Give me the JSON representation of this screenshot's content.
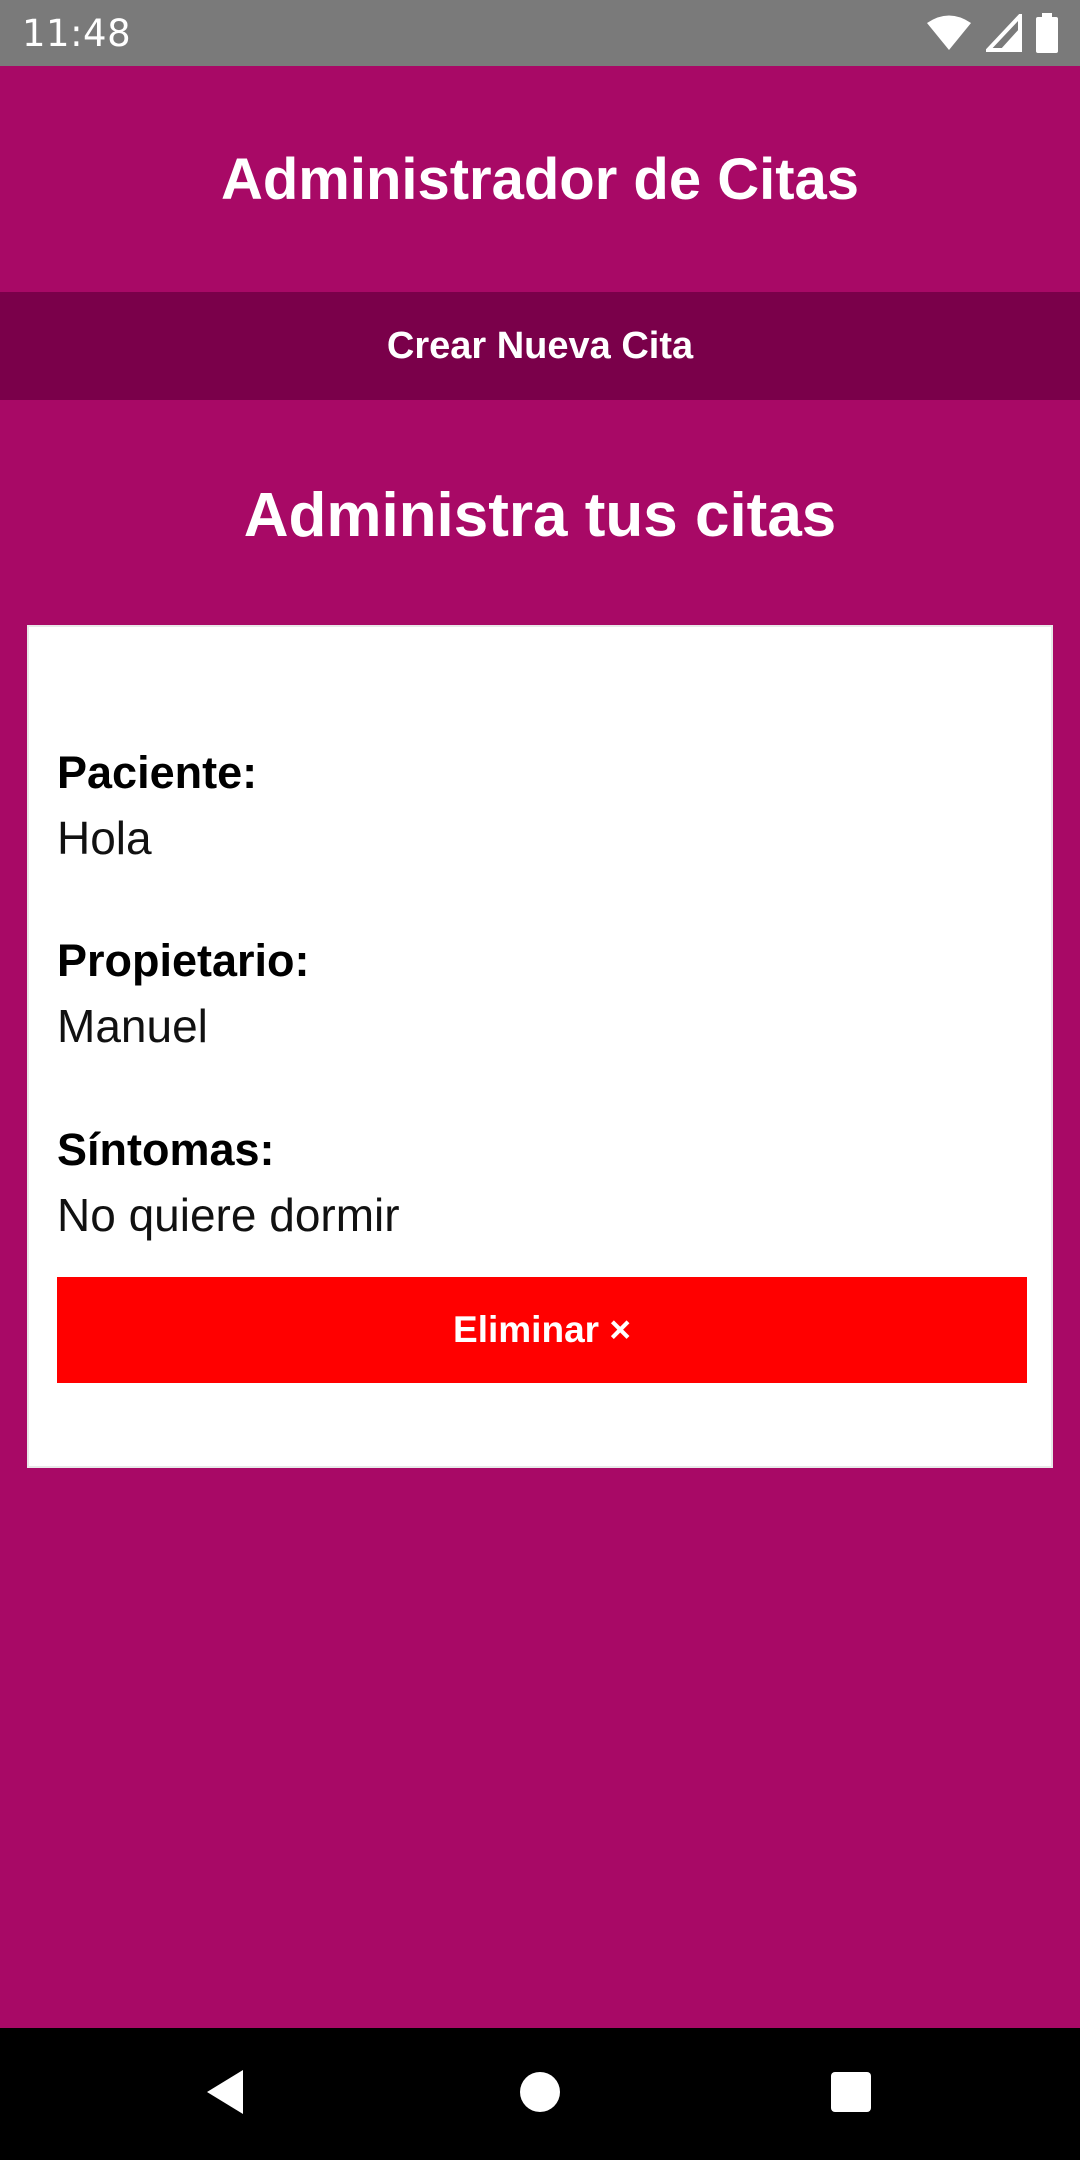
{
  "status_bar": {
    "time": "11:48",
    "icons": [
      "wifi-icon",
      "cell-signal-icon",
      "battery-icon"
    ]
  },
  "header": {
    "title": "Administrador de Citas"
  },
  "toolbar": {
    "new_appointment_label": "Crear Nueva Cita"
  },
  "main": {
    "section_title": "Administra tus citas",
    "appointment": {
      "patient_label": "Paciente:",
      "patient_value": "Hola",
      "owner_label": "Propietario:",
      "owner_value": "Manuel",
      "symptoms_label": "Síntomas:",
      "symptoms_value": "No quiere dormir",
      "delete_label": "Eliminar ×"
    }
  },
  "nav_bar": {
    "icons": [
      "back-icon",
      "home-icon",
      "recents-icon"
    ]
  },
  "colors": {
    "background": "#a80966",
    "new_appointment_bar": "#7a004a",
    "delete_button": "#ff0000",
    "status_bar": "#7a7a7a",
    "nav_bar": "#000000"
  }
}
